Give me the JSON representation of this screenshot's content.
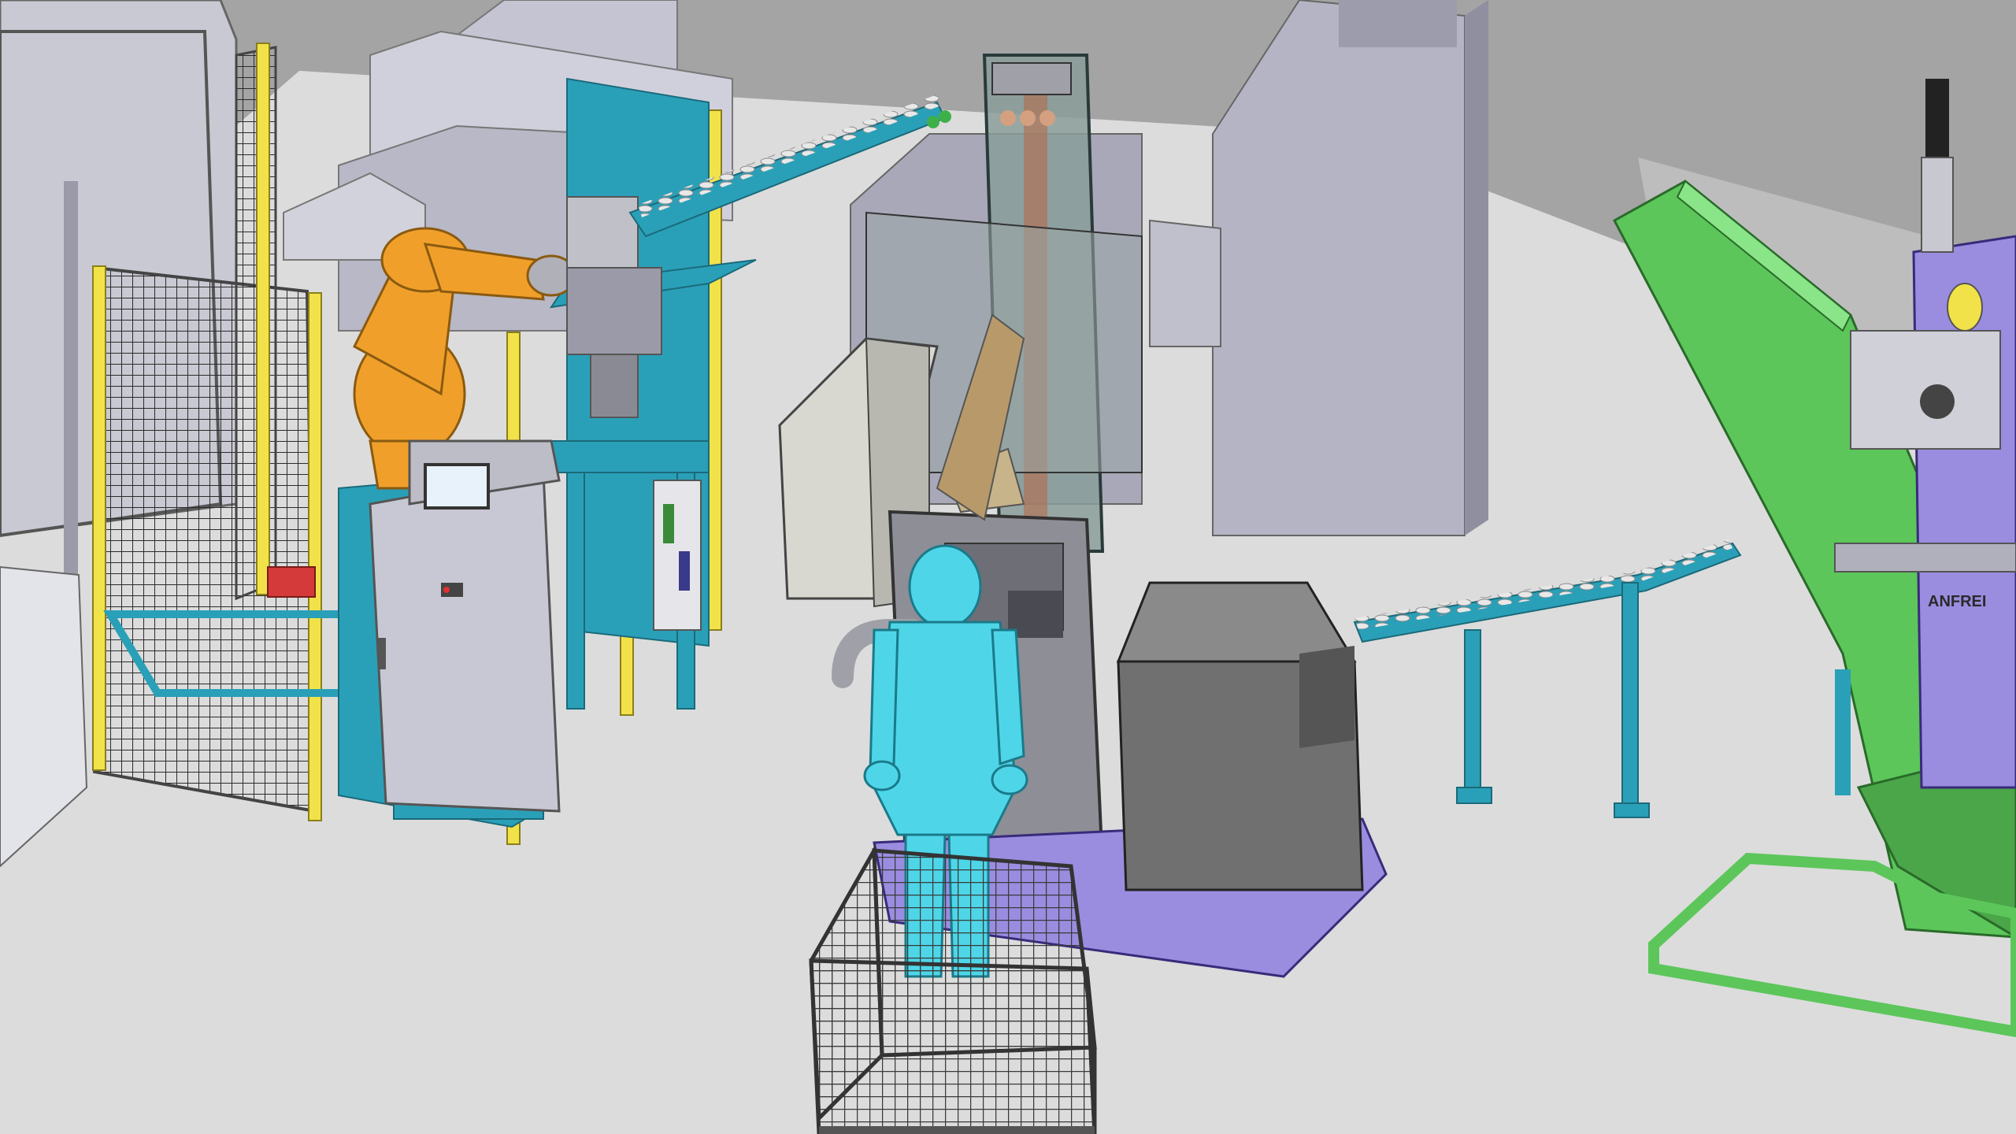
{
  "scene": {
    "components": [
      {
        "id": "background-machines",
        "kind": "machine"
      },
      {
        "id": "safety-fence-left",
        "kind": "guard"
      },
      {
        "id": "robot-arm",
        "kind": "robot",
        "color": "#f0a02a"
      },
      {
        "id": "control-cabinet",
        "kind": "cabinet",
        "hmi": true
      },
      {
        "id": "robot-station-frame",
        "kind": "frame",
        "color": "#2aa0b8"
      },
      {
        "id": "roller-conveyor-upper",
        "kind": "conveyor",
        "color": "#2aa0b8"
      },
      {
        "id": "vertical-lift-tower",
        "kind": "elevator"
      },
      {
        "id": "electrical-enclosure",
        "kind": "enclosure"
      },
      {
        "id": "inspection-machine",
        "kind": "machine"
      },
      {
        "id": "grey-cabinet-on-platform",
        "kind": "cabinet"
      },
      {
        "id": "operator-mannequin",
        "kind": "person",
        "color": "#4ed6e8"
      },
      {
        "id": "wire-mesh-basket",
        "kind": "container"
      },
      {
        "id": "roller-conveyor-lower",
        "kind": "conveyor",
        "color": "#2aa0b8"
      },
      {
        "id": "green-chute",
        "kind": "chute",
        "color": "#5cc65a"
      },
      {
        "id": "lift-unit-right",
        "kind": "lift",
        "color": "#9a8de0"
      }
    ],
    "stencil_text": "ANFREI"
  },
  "colors": {
    "floor": "#d9d9d9",
    "wall": "#a2a2a2",
    "machine_grey": "#c8c8d4",
    "teal": "#2aa0b8",
    "yellow_post": "#f2e24a",
    "orange": "#f0a02a",
    "green": "#5cc65a",
    "violet": "#9a8de0",
    "mannequin": "#4ed6e8"
  }
}
